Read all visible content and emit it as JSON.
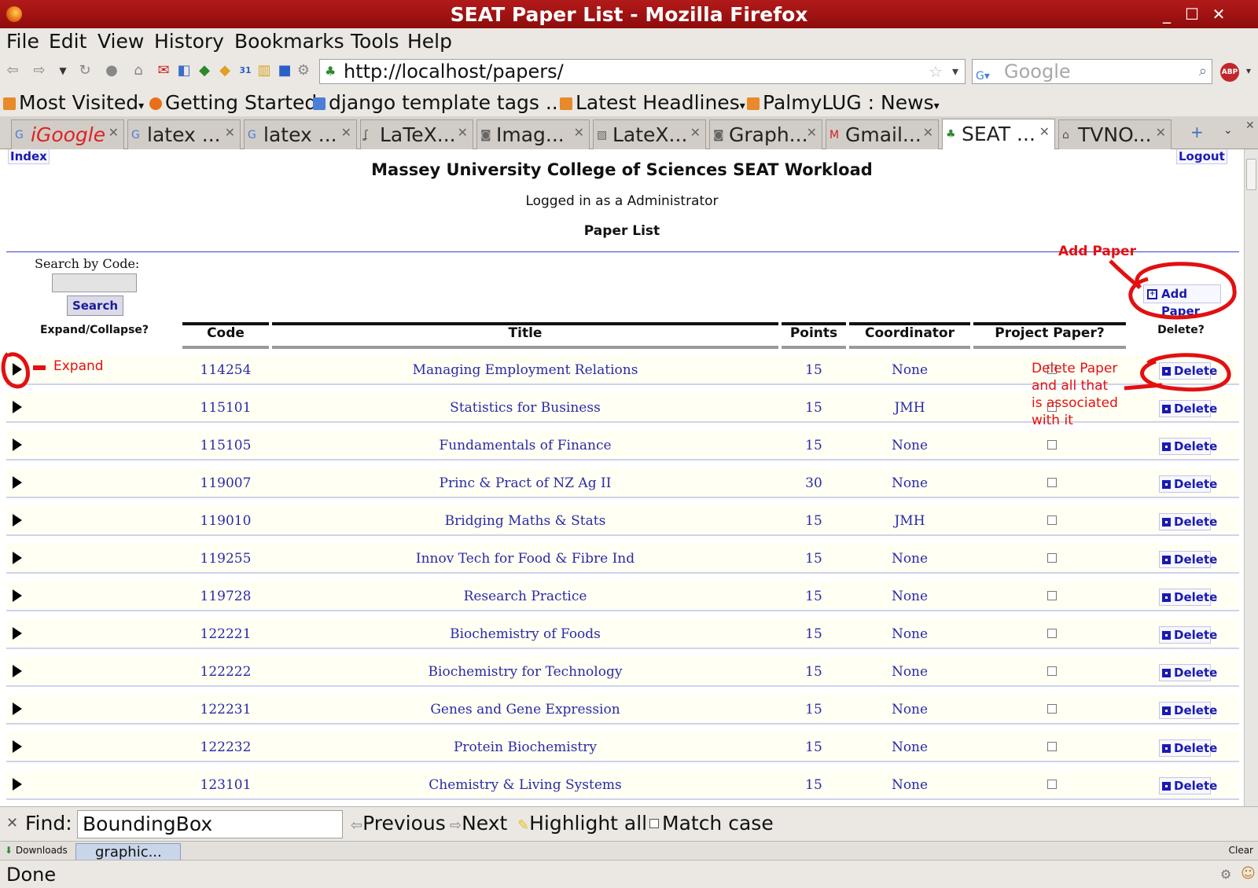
{
  "window": {
    "title": "SEAT Paper List - Mozilla Firefox"
  },
  "menu": [
    "File",
    "Edit",
    "View",
    "History",
    "Bookmarks",
    "Tools",
    "Help"
  ],
  "nav": {
    "url": "http://localhost/papers/",
    "search_placeholder": "Google"
  },
  "bookmarks": [
    "Most Visited",
    "Getting Started",
    "django template tags ...",
    "Latest Headlines",
    "PalmyLUG : News"
  ],
  "tabs": [
    "iGoogle",
    "latex ...",
    "latex ...",
    "LaTeX...",
    "Imag...",
    "LateX...",
    "Graph...",
    "Gmail...",
    "SEAT ...",
    "TVNO..."
  ],
  "page": {
    "index_link": "Index",
    "logout_link": "Logout",
    "heading": "Massey University College of Sciences SEAT Workload",
    "logged_in": "Logged in as a Administrator",
    "subheading": "Paper List",
    "search_label": "Search by Code:",
    "search_button": "Search",
    "add_paper_button": "Add Paper",
    "expand_collapse_label": "Expand/Collapse?",
    "delete_header": "Delete?",
    "columns": [
      "Code",
      "Title",
      "Points",
      "Coordinator",
      "Project Paper?"
    ],
    "delete_label": "Delete"
  },
  "papers": [
    {
      "code": "114254",
      "title": "Managing Employment Relations",
      "points": "15",
      "coordinator": "None",
      "project": false
    },
    {
      "code": "115101",
      "title": "Statistics for Business",
      "points": "15",
      "coordinator": "JMH",
      "project": false
    },
    {
      "code": "115105",
      "title": "Fundamentals of Finance",
      "points": "15",
      "coordinator": "None",
      "project": false
    },
    {
      "code": "119007",
      "title": "Princ & Pract of NZ Ag II",
      "points": "30",
      "coordinator": "None",
      "project": false
    },
    {
      "code": "119010",
      "title": "Bridging Maths & Stats",
      "points": "15",
      "coordinator": "JMH",
      "project": false
    },
    {
      "code": "119255",
      "title": "Innov Tech for Food & Fibre Ind",
      "points": "15",
      "coordinator": "None",
      "project": false
    },
    {
      "code": "119728",
      "title": "Research Practice",
      "points": "15",
      "coordinator": "None",
      "project": false
    },
    {
      "code": "122221",
      "title": "Biochemistry of Foods",
      "points": "15",
      "coordinator": "None",
      "project": false
    },
    {
      "code": "122222",
      "title": "Biochemistry for Technology",
      "points": "15",
      "coordinator": "None",
      "project": false
    },
    {
      "code": "122231",
      "title": "Genes and Gene Expression",
      "points": "15",
      "coordinator": "None",
      "project": false
    },
    {
      "code": "122232",
      "title": "Protein Biochemistry",
      "points": "15",
      "coordinator": "None",
      "project": false
    },
    {
      "code": "123101",
      "title": "Chemistry & Living Systems",
      "points": "15",
      "coordinator": "None",
      "project": false
    }
  ],
  "annotations": {
    "add_paper": "Add Paper",
    "expand": "Expand",
    "delete_note": [
      "Delete Paper",
      "and all that",
      "is associated",
      "with it"
    ],
    "color": "#e21010"
  },
  "findbar": {
    "label": "Find:",
    "value": "BoundingBox",
    "previous": "Previous",
    "next": "Next",
    "highlight": "Highlight all",
    "match_case": "Match case"
  },
  "downloads": {
    "label": "Downloads",
    "item": "graphic...",
    "clear": "Clear"
  },
  "status": "Done"
}
